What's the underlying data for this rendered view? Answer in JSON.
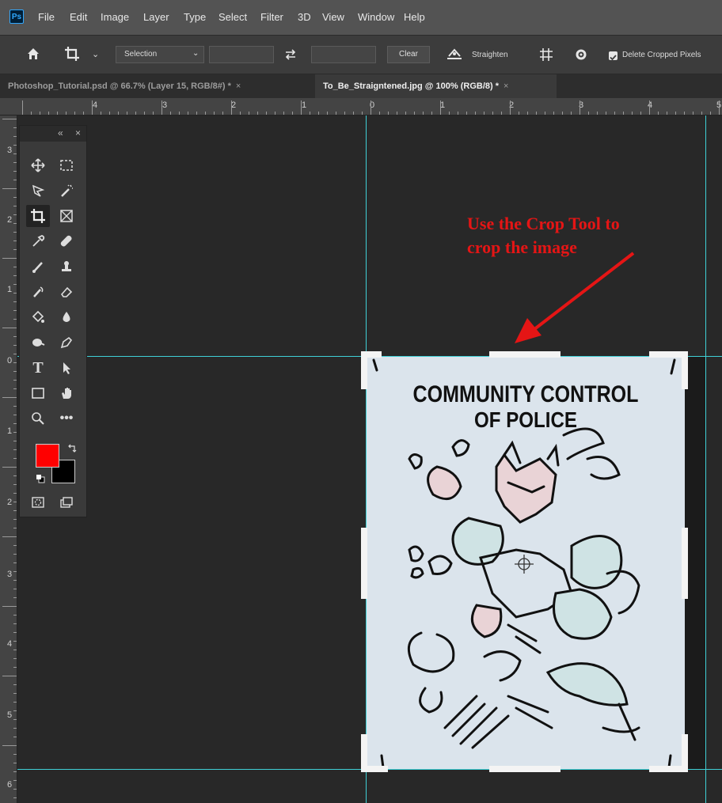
{
  "menubar": {
    "logo": "Ps",
    "items": [
      "File",
      "Edit",
      "Image",
      "Layer",
      "Type",
      "Select",
      "Filter",
      "3D",
      "View",
      "Window",
      "Help"
    ]
  },
  "options": {
    "ratio_select": "Selection",
    "clear_label": "Clear",
    "straighten_label": "Straighten",
    "delete_cropped_label": "Delete Cropped Pixels",
    "delete_cropped_checked": true
  },
  "tabs": [
    {
      "label": "Photoshop_Tutorial.psd @ 66.7% (Layer 15, RGB/8#) *",
      "close": "×"
    },
    {
      "label": "To_Be_Straigntened.jpg @ 100% (RGB/8) *",
      "close": "×"
    }
  ],
  "ruler_top": [
    "4",
    "3",
    "2",
    "1",
    "0",
    "1",
    "2",
    "3",
    "4",
    "5"
  ],
  "ruler_left": [
    "3",
    "2",
    "1",
    "0",
    "1",
    "2",
    "3",
    "4",
    "5",
    "6"
  ],
  "toolbox": {
    "collapse": "«",
    "close": "×",
    "foreground_color": "#ff0000",
    "background_color": "#000000"
  },
  "annotation": {
    "line1": "Use the Crop Tool to",
    "line2": "crop the image",
    "color": "#e51515"
  },
  "poster": {
    "line1": "COMMUNITY CONTROL",
    "line2": "OF POLICE"
  }
}
